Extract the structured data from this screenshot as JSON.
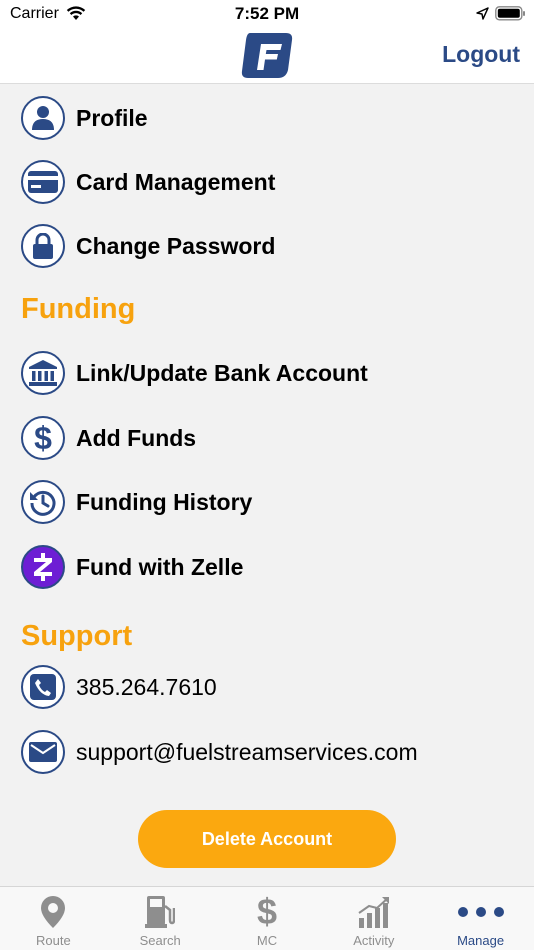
{
  "status_bar": {
    "carrier": "Carrier",
    "time": "7:52 PM"
  },
  "header": {
    "logout_label": "Logout"
  },
  "account_items": [
    {
      "label": "Profile",
      "icon": "person-icon"
    },
    {
      "label": "Card Management",
      "icon": "credit-card-icon"
    },
    {
      "label": "Change Password",
      "icon": "lock-icon"
    }
  ],
  "funding": {
    "title": "Funding",
    "items": [
      {
        "label": "Link/Update Bank Account",
        "icon": "bank-icon"
      },
      {
        "label": "Add Funds",
        "icon": "dollar-icon"
      },
      {
        "label": "Funding History",
        "icon": "history-icon"
      },
      {
        "label": "Fund with Zelle",
        "icon": "zelle-icon"
      }
    ]
  },
  "support": {
    "title": "Support",
    "items": [
      {
        "label": "385.264.7610",
        "icon": "phone-icon"
      },
      {
        "label": "support@fuelstreamservices.com",
        "icon": "mail-icon"
      }
    ]
  },
  "delete_button": {
    "label": "Delete Account"
  },
  "tabs": [
    {
      "label": "Route",
      "icon": "map-pin-icon",
      "active": false
    },
    {
      "label": "Search",
      "icon": "fuel-pump-icon",
      "active": false
    },
    {
      "label": "MC",
      "icon": "dollar-sign-icon",
      "active": false
    },
    {
      "label": "Activity",
      "icon": "bar-chart-icon",
      "active": false
    },
    {
      "label": "Manage",
      "icon": "more-dots-icon",
      "active": true
    }
  ],
  "colors": {
    "brand_blue": "#2b4a86",
    "accent_orange": "#f7a20e",
    "button_orange": "#fba80f",
    "zelle_purple": "#6d1ed4"
  }
}
